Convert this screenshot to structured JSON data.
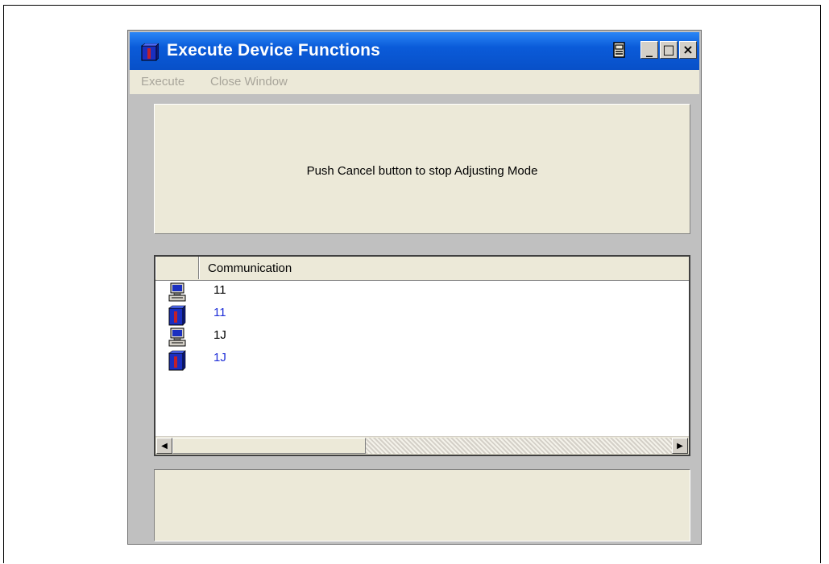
{
  "window": {
    "title": "Execute Device Functions",
    "title_bar_color": "#0a5bd9",
    "app_icon": "device-block-icon",
    "controls": {
      "print_icon": "printer-icon",
      "minimize": "_",
      "maximize": "□",
      "close": "×"
    }
  },
  "menu": {
    "items": [
      {
        "label": "Execute",
        "enabled": false
      },
      {
        "label": "Close Window",
        "enabled": false
      }
    ]
  },
  "message_panel": {
    "text": "Push Cancel button to stop Adjusting Mode"
  },
  "list": {
    "columns": [
      "",
      "Communication"
    ],
    "rows": [
      {
        "icon": "computer-icon",
        "text": "11",
        "color": "#000000"
      },
      {
        "icon": "device-block-icon",
        "text": "11",
        "color": "#1f2fd8"
      },
      {
        "icon": "computer-icon",
        "text": "1J",
        "color": "#000000"
      },
      {
        "icon": "device-block-icon",
        "text": "1J",
        "color": "#1f2fd8"
      }
    ]
  },
  "scrollbar": {
    "left_arrow": "◀",
    "right_arrow": "▶"
  },
  "status_panel": {
    "text": ""
  }
}
